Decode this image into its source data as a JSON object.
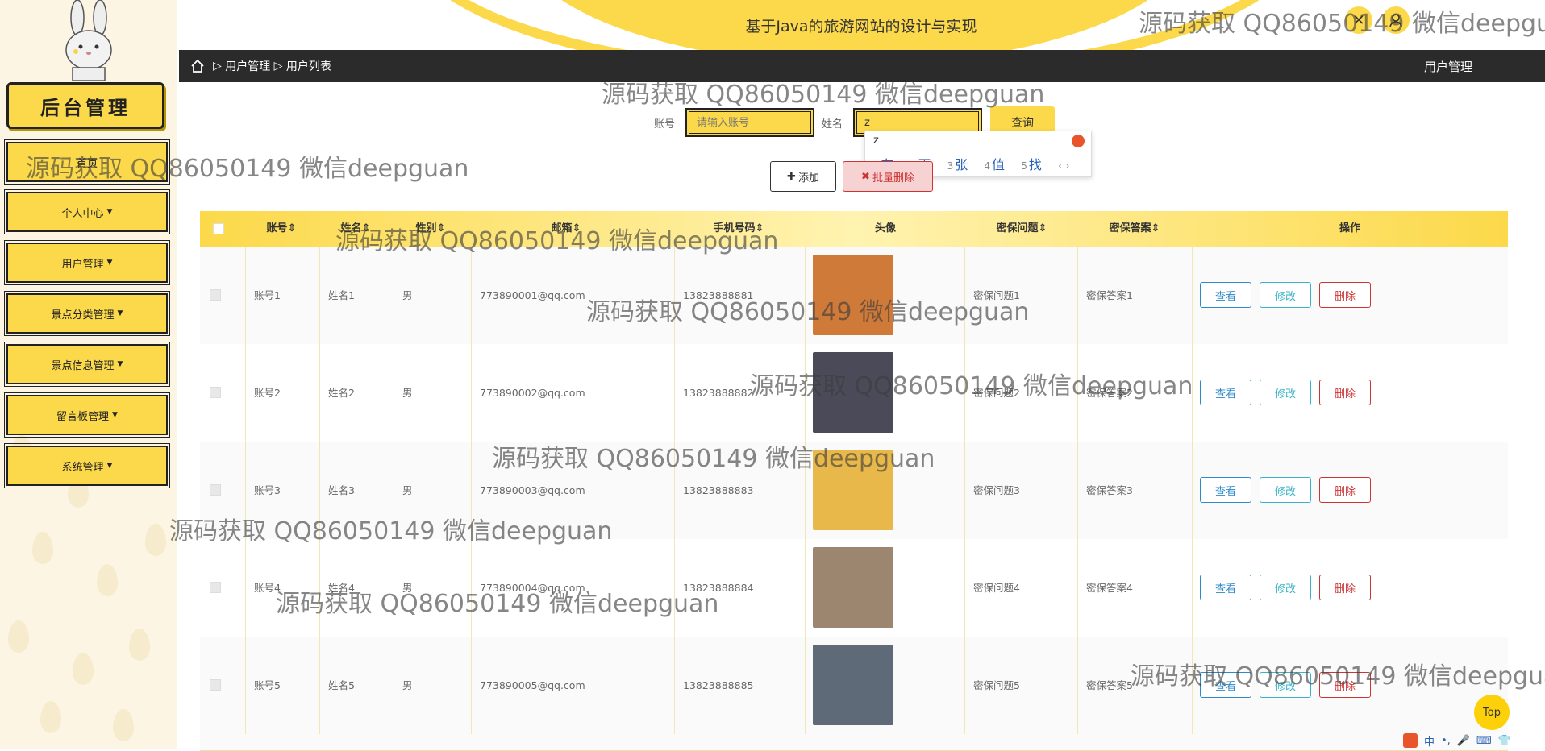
{
  "brand": {
    "title": "后台管理"
  },
  "sidebar": {
    "items": [
      {
        "label": "首页",
        "has_caret": false
      },
      {
        "label": "个人中心",
        "has_caret": true
      },
      {
        "label": "用户管理",
        "has_caret": true
      },
      {
        "label": "景点分类管理",
        "has_caret": true
      },
      {
        "label": "景点信息管理",
        "has_caret": true
      },
      {
        "label": "留言板管理",
        "has_caret": true
      },
      {
        "label": "系统管理",
        "has_caret": true
      }
    ]
  },
  "header": {
    "site_title": "基于Java的旅游网站的设计与实现"
  },
  "breadcrumb": {
    "level1": "用户管理",
    "level2": "用户列表",
    "right_title": "用户管理"
  },
  "search": {
    "account_label": "账号",
    "account_placeholder": "请输入账号",
    "account_value": "",
    "name_label": "姓名",
    "name_value": "z",
    "query_label": "查询"
  },
  "ime": {
    "pinyin": "z",
    "candidates": [
      {
        "num": "1",
        "text": "在"
      },
      {
        "num": "2",
        "text": "再"
      },
      {
        "num": "3",
        "text": "张"
      },
      {
        "num": "4",
        "text": "值"
      },
      {
        "num": "5",
        "text": "找"
      }
    ],
    "nav": "‹ ›"
  },
  "toolbar": {
    "add_label": "添加",
    "batch_delete_label": "批量删除"
  },
  "table": {
    "columns": [
      "账号",
      "姓名",
      "性别",
      "邮箱",
      "手机号码",
      "头像",
      "密保问题",
      "密保答案",
      "操作"
    ],
    "sortable": [
      true,
      true,
      true,
      true,
      true,
      false,
      true,
      true,
      false
    ],
    "rows": [
      {
        "account": "账号1",
        "name": "姓名1",
        "gender": "男",
        "email": "773890001@qq.com",
        "phone": "13823888881",
        "question": "密保问题1",
        "answer": "密保答案1",
        "avatar_color": "#d07a3a"
      },
      {
        "account": "账号2",
        "name": "姓名2",
        "gender": "男",
        "email": "773890002@qq.com",
        "phone": "13823888882",
        "question": "密保问题2",
        "answer": "密保答案2",
        "avatar_color": "#4a4a58"
      },
      {
        "account": "账号3",
        "name": "姓名3",
        "gender": "男",
        "email": "773890003@qq.com",
        "phone": "13823888883",
        "question": "密保问题3",
        "answer": "密保答案3",
        "avatar_color": "#e8b84a"
      },
      {
        "account": "账号4",
        "name": "姓名4",
        "gender": "男",
        "email": "773890004@qq.com",
        "phone": "13823888884",
        "question": "密保问题4",
        "answer": "密保答案4",
        "avatar_color": "#9c8670"
      },
      {
        "account": "账号5",
        "name": "姓名5",
        "gender": "男",
        "email": "773890005@qq.com",
        "phone": "13823888885",
        "question": "密保问题5",
        "answer": "密保答案5",
        "avatar_color": "#5e6a78"
      }
    ],
    "actions": {
      "view": "查看",
      "edit": "修改",
      "delete": "删除"
    }
  },
  "watermark": {
    "text": "源码获取 QQ86050149 微信deepguan"
  },
  "back_to_top": {
    "label": "Top"
  },
  "ime_status": {
    "label": "中"
  },
  "colors": {
    "accent": "#fcd94a",
    "dark": "#2b2b2b",
    "danger": "#cc3333",
    "info": "#2d8ac7"
  }
}
